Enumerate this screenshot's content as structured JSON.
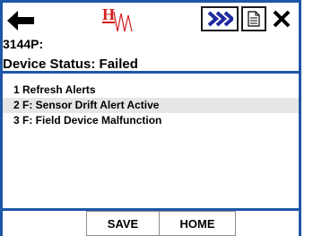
{
  "header": {
    "logo_text": "HW",
    "device_id": "3144P:",
    "status": "Device Status: Failed"
  },
  "toolbar": {
    "back_icon": "arrow-left-icon",
    "next_icon": "fast-forward-icon",
    "doc_icon": "document-icon",
    "close_icon": "close-icon"
  },
  "menu": {
    "items": [
      {
        "label": "1 Refresh Alerts",
        "selected": false
      },
      {
        "label": "2 F: Sensor Drift Alert Active",
        "selected": true
      },
      {
        "label": "3 F: Field Device Malfunction",
        "selected": false
      }
    ]
  },
  "footer": {
    "save_label": "SAVE",
    "home_label": "HOME"
  },
  "colors": {
    "frame_blue": "#1f56a6",
    "logo_red": "#d41e1e",
    "selected_row": "#e6e6e6"
  }
}
